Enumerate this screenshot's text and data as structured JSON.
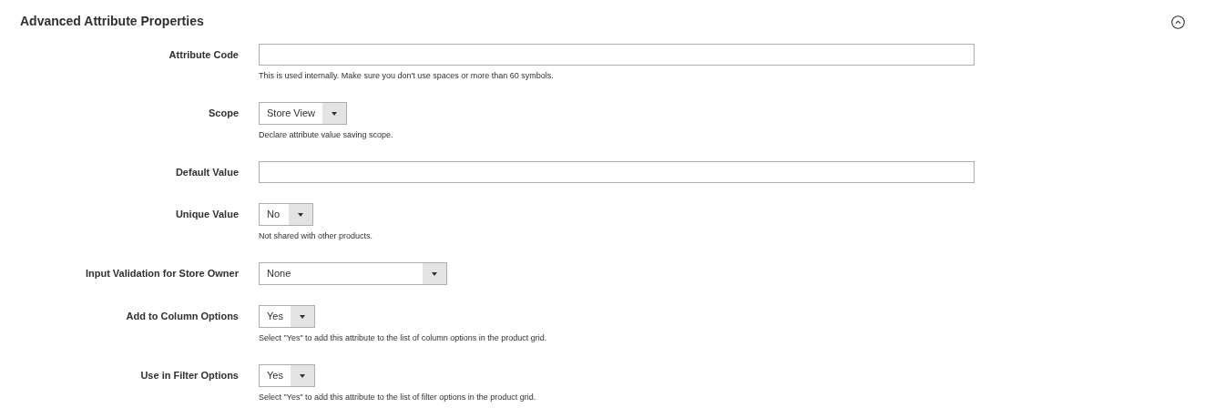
{
  "section": {
    "title": "Advanced Attribute Properties",
    "expanded": true
  },
  "fields": [
    {
      "label": "Attribute Code",
      "kind": "text",
      "note": "This is used internally. Make sure you don't use spaces or more than 60 symbols."
    },
    {
      "label": "Scope",
      "kind": "select",
      "value": "Store View",
      "note": "Declare attribute value saving scope."
    },
    {
      "label": "Default Value",
      "kind": "text"
    },
    {
      "label": "Unique Value",
      "kind": "select",
      "value": "No",
      "note": "Not shared with other products."
    },
    {
      "label": "Input Validation for Store Owner",
      "kind": "wide-select",
      "value": "None"
    },
    {
      "label": "Add to Column Options",
      "kind": "select",
      "value": "Yes",
      "note": "Select \"Yes\" to add this attribute to the list of column options in the product grid."
    },
    {
      "label": "Use in Filter Options",
      "kind": "select",
      "value": "Yes",
      "note": "Select \"Yes\" to add this attribute to the list of filter options in the product grid."
    }
  ]
}
